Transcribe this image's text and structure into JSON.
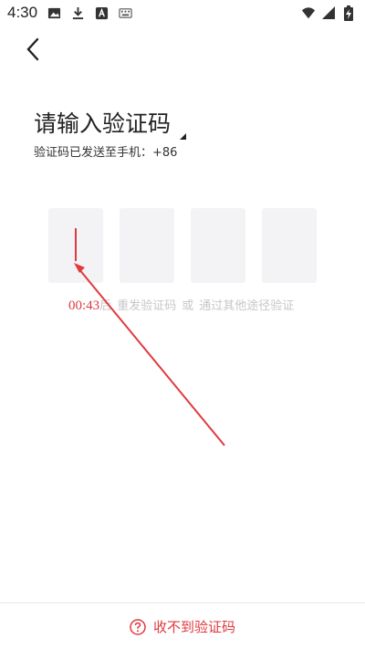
{
  "status_bar": {
    "time": "4:30",
    "icons_left": [
      "image-icon",
      "download-icon",
      "a-box-icon",
      "keyboard-icon"
    ],
    "icons_right": [
      "wifi-icon",
      "signal-icon",
      "battery-charging-icon"
    ]
  },
  "header": {
    "back_icon": "chevron-left-icon"
  },
  "main": {
    "title": "请输入验证码",
    "subtitle": "验证码已发送至手机：+86",
    "code_boxes": [
      "",
      "",
      "",
      ""
    ],
    "countdown": "00:43",
    "countdown_suffix": "后",
    "resend_label": "重发验证码",
    "or_label": "或",
    "other_method_label": "通过其他途径验证"
  },
  "footer": {
    "help_label": "收不到验证码",
    "help_icon": "question-circle-icon"
  },
  "colors": {
    "accent": "#e0393e",
    "box_bg": "#f3f3f5",
    "muted": "#c7c7c7"
  }
}
